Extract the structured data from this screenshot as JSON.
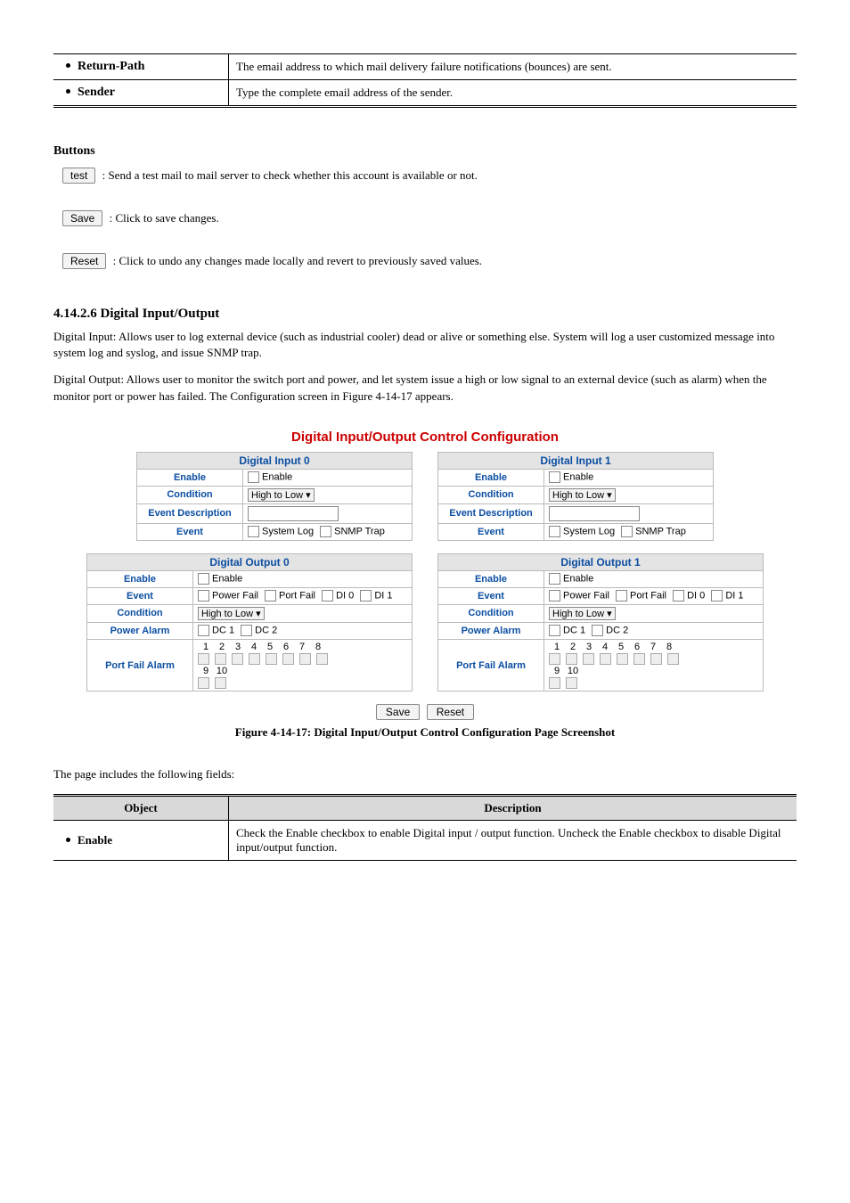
{
  "top_table": {
    "rows": [
      {
        "label": "Return-Path",
        "desc": "The email address to which mail delivery failure notifications (bounces) are sent."
      },
      {
        "label": "Sender",
        "desc": "Type the complete email address of the sender."
      }
    ]
  },
  "buttons_section": {
    "heading": "Buttons",
    "items": [
      {
        "btn": "test",
        "desc": ": Send a test mail to mail server to check whether this account is available or not."
      },
      {
        "btn": "Save",
        "desc": ": Click to save changes."
      },
      {
        "btn": "Reset",
        "desc": ": Click to undo any changes made locally and revert to previously saved values."
      }
    ]
  },
  "section_heading": "4.14.2.6 Digital Input/Output",
  "intro_para_1": "Digital Input: Allows user to log external device (such as industrial cooler) dead or alive or something else. System will log a user customized message into system log and syslog, and issue SNMP trap.",
  "intro_para_2": "Digital Output: Allows user to monitor the switch port and power, and let system issue a high or low signal to an external device (such as alarm) when the monitor port or power has failed. The Configuration screen in Figure 4-14-17 appears.",
  "fig_title": "Digital Input/Output Control Configuration",
  "input_block": {
    "h0": "Digital Input 0",
    "h1": "Digital Input 1",
    "rows": {
      "enable": "Enable",
      "condition": "Condition",
      "event_desc": "Event Description",
      "event": "Event"
    },
    "enable_lbl": "Enable",
    "condition_val": "High to Low ▾",
    "event_sys": "System Log",
    "event_trap": "SNMP Trap"
  },
  "output_block": {
    "h0": "Digital Output 0",
    "h1": "Digital Output 1",
    "rows": {
      "enable": "Enable",
      "event": "Event",
      "condition": "Condition",
      "power_alarm": "Power Alarm",
      "port_fail": "Port Fail Alarm"
    },
    "enable_lbl": "Enable",
    "event_opts": {
      "pf": "Power Fail",
      "ptf": "Port Fail",
      "di0": "DI 0",
      "di1": "DI 1"
    },
    "condition_val": "High to Low ▾",
    "dc1": "DC 1",
    "dc2": "DC 2",
    "ports_a": [
      1,
      2,
      3,
      4,
      5,
      6,
      7,
      8
    ],
    "ports_b": [
      9,
      10
    ]
  },
  "save_btn": "Save",
  "reset_btn": "Reset",
  "fig_caption": "Figure 4-14-17: Digital Input/Output Control Configuration Page Screenshot",
  "lower_intro": "The page includes the following fields:",
  "lower_table": {
    "h_obj": "Object",
    "h_desc": "Description",
    "row1_label": "Enable",
    "row1_desc": "Check the Enable checkbox to enable Digital input / output function. Uncheck the Enable checkbox to disable Digital input/output function."
  }
}
